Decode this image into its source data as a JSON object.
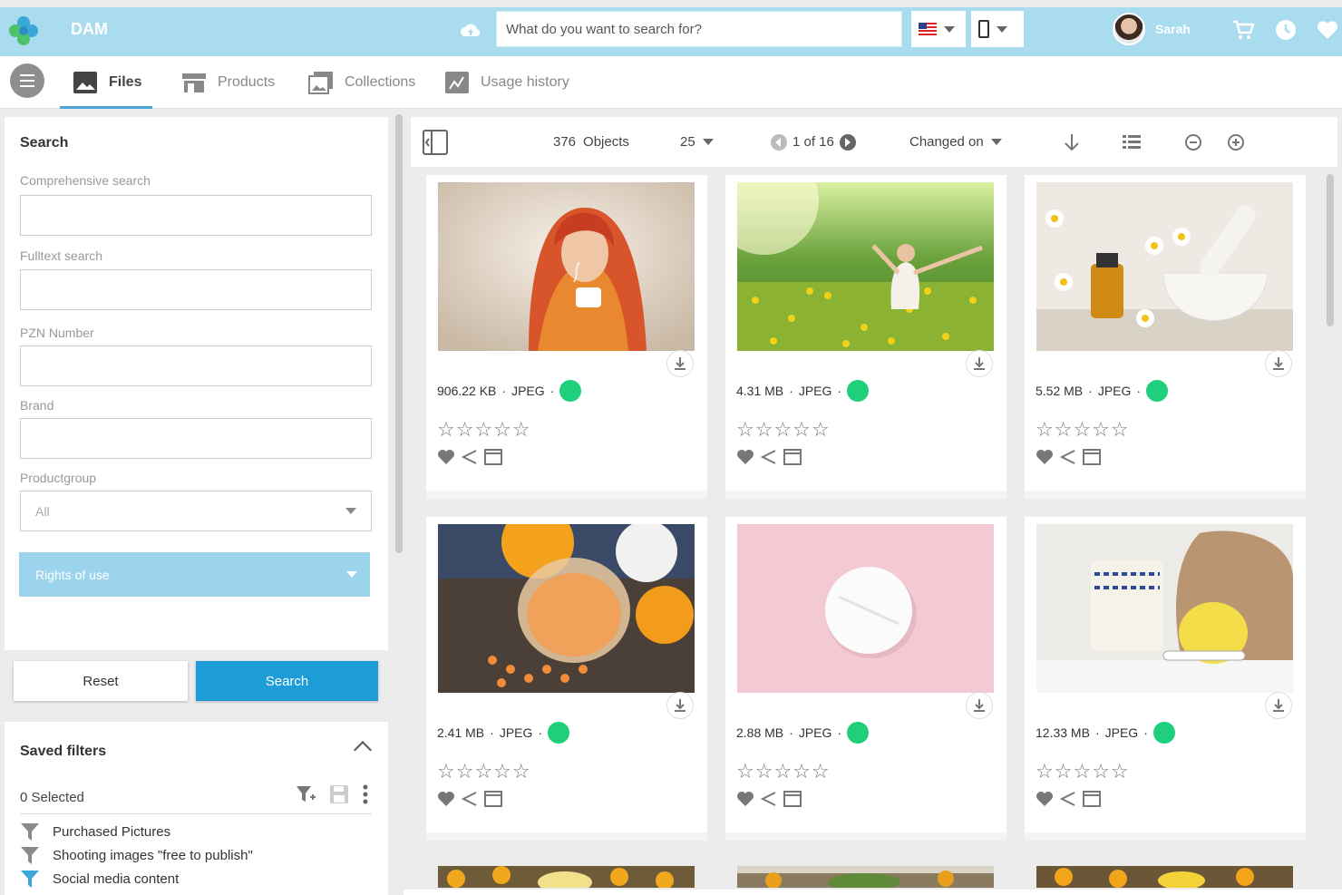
{
  "topbar": {
    "app_title": "DAM",
    "search_placeholder": "What do you want to search for?",
    "user_name": "Sarah",
    "icons": [
      "logo-icon",
      "cloud-icon",
      "flag-us-icon",
      "phone-icon",
      "cart-icon",
      "clock-icon",
      "heart-icon"
    ]
  },
  "tabs": [
    {
      "label": "Files",
      "icon": "image-icon",
      "active": true
    },
    {
      "label": "Products",
      "icon": "store-icon",
      "active": false
    },
    {
      "label": "Collections",
      "icon": "collections-icon",
      "active": false
    },
    {
      "label": "Usage history",
      "icon": "chart-icon",
      "active": false
    }
  ],
  "search_panel": {
    "title": "Search",
    "comprehensive_label": "Comprehensive search",
    "fulltext_label": "Fulltext search",
    "pzn_label": "PZN Number",
    "brand_label": "Brand",
    "productgroup_label": "Productgroup",
    "productgroup_value": "All",
    "rights_label": "Rights of use",
    "reset_label": "Reset",
    "search_label": "Search"
  },
  "saved_filters": {
    "title": "Saved filters",
    "selected_text": "0 Selected",
    "items": [
      {
        "label": "Purchased Pictures",
        "color": "#8a8a8a"
      },
      {
        "label": "Shooting images \"free to publish\"",
        "color": "#8a8a8a"
      },
      {
        "label": "Social media content",
        "color": "#3aa8d8"
      }
    ]
  },
  "toolbar": {
    "objects": "376",
    "objects_label": "Objects",
    "page_size": "25",
    "page_info": "1 of 16",
    "sort_label": "Changed on"
  },
  "assets": [
    {
      "size": "906.22 KB",
      "format": "JPEG",
      "status_color": "#1fcf7c",
      "subject": "woman-in-blanket-with-tea"
    },
    {
      "size": "4.31 MB",
      "format": "JPEG",
      "status_color": "#1fcf7c",
      "subject": "woman-in-meadow"
    },
    {
      "size": "5.52 MB",
      "format": "JPEG",
      "status_color": "#1fcf7c",
      "subject": "chamomile-and-mortar"
    },
    {
      "size": "2.41 MB",
      "format": "JPEG",
      "status_color": "#1fcf7c",
      "subject": "bath-salt-jar-with-oranges"
    },
    {
      "size": "2.88 MB",
      "format": "JPEG",
      "status_color": "#1fcf7c",
      "subject": "white-tablet-on-pink"
    },
    {
      "size": "12.33 MB",
      "format": "JPEG",
      "status_color": "#1fcf7c",
      "subject": "tea-cup-lemon-thermometer"
    }
  ],
  "colors": {
    "topbar": "#a8dcee",
    "accent": "#1e9cd8",
    "rights_button": "#9bd4ec",
    "status_ok": "#1fcf7c"
  }
}
